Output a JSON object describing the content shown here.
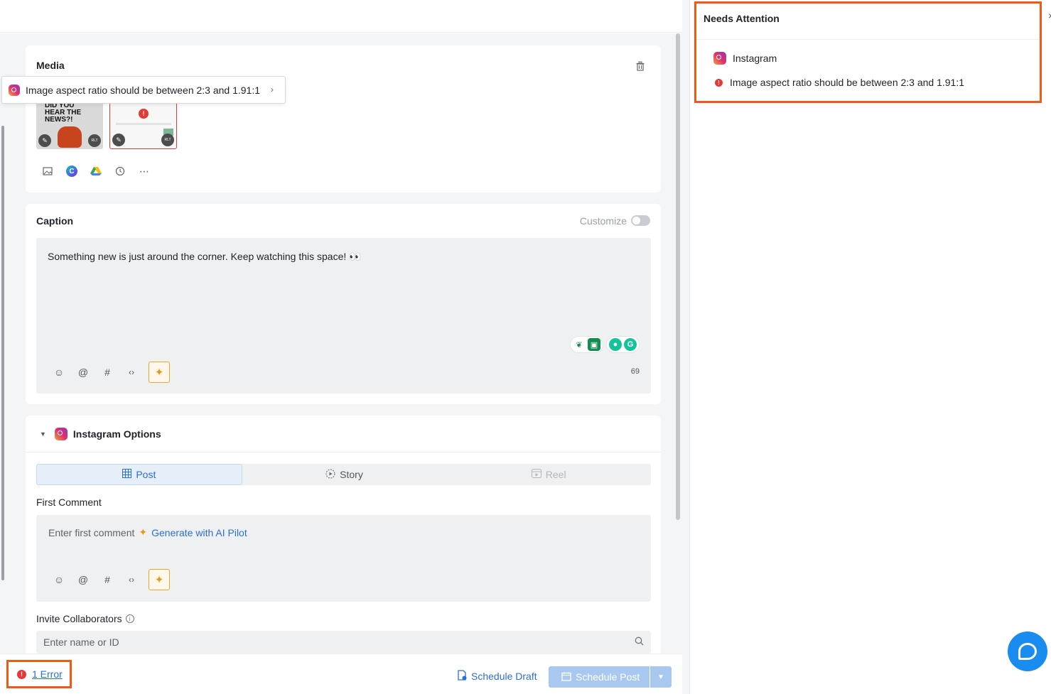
{
  "media": {
    "title": "Media",
    "tooltip_text": "Image aspect ratio should be between 2:3 and 1.91:1",
    "thumb1_text": "DID YOU HEAR THE NEWS?!",
    "thumb_alt_label": "RLT"
  },
  "caption": {
    "title": "Caption",
    "customize_label": "Customize",
    "text": "Something new is just around the corner. Keep watching this space! 👀",
    "char_count": "69"
  },
  "instagram_options": {
    "title": "Instagram Options",
    "tabs": [
      {
        "label": "Post",
        "state": "active"
      },
      {
        "label": "Story",
        "state": "normal"
      },
      {
        "label": "Reel",
        "state": "disabled"
      }
    ],
    "first_comment_label": "First Comment",
    "first_comment_placeholder": "Enter first comment",
    "generate_label": "Generate with AI Pilot",
    "invite_label": "Invite Collaborators",
    "invite_placeholder": "Enter name or ID"
  },
  "footer": {
    "error_label": "1 Error",
    "schedule_draft_label": "Schedule Draft",
    "schedule_post_label": "Schedule Post"
  },
  "needs_attention": {
    "title": "Needs Attention",
    "platform": "Instagram",
    "message": "Image aspect ratio should be between 2:3 and 1.91:1"
  },
  "colors": {
    "accent": "#2a6fd6",
    "error": "#e53935",
    "highlight": "#f05a15"
  }
}
